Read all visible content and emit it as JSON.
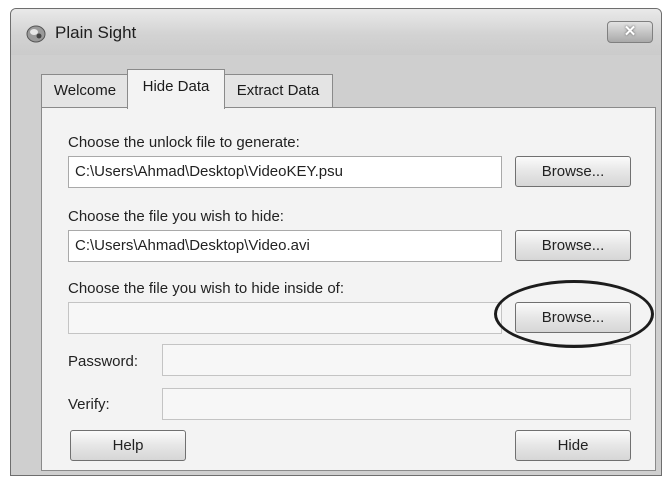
{
  "window": {
    "title": "Plain Sight",
    "close_label": "✕"
  },
  "tabs": [
    {
      "label": "Welcome",
      "active": false
    },
    {
      "label": "Hide Data",
      "active": true
    },
    {
      "label": "Extract Data",
      "active": false
    }
  ],
  "hide_data": {
    "unlock_file": {
      "label": "Choose the unlock file to generate:",
      "value": "C:\\Users\\Ahmad\\Desktop\\VideoKEY.psu",
      "browse_label": "Browse..."
    },
    "file_to_hide": {
      "label": "Choose the file you wish to hide:",
      "value": "C:\\Users\\Ahmad\\Desktop\\Video.avi",
      "browse_label": "Browse..."
    },
    "host_file": {
      "label": "Choose the file you wish to hide inside of:",
      "value": "",
      "browse_label": "Browse..."
    },
    "password": {
      "label": "Password:",
      "value": ""
    },
    "verify": {
      "label": "Verify:",
      "value": ""
    },
    "help_label": "Help",
    "hide_label": "Hide"
  }
}
